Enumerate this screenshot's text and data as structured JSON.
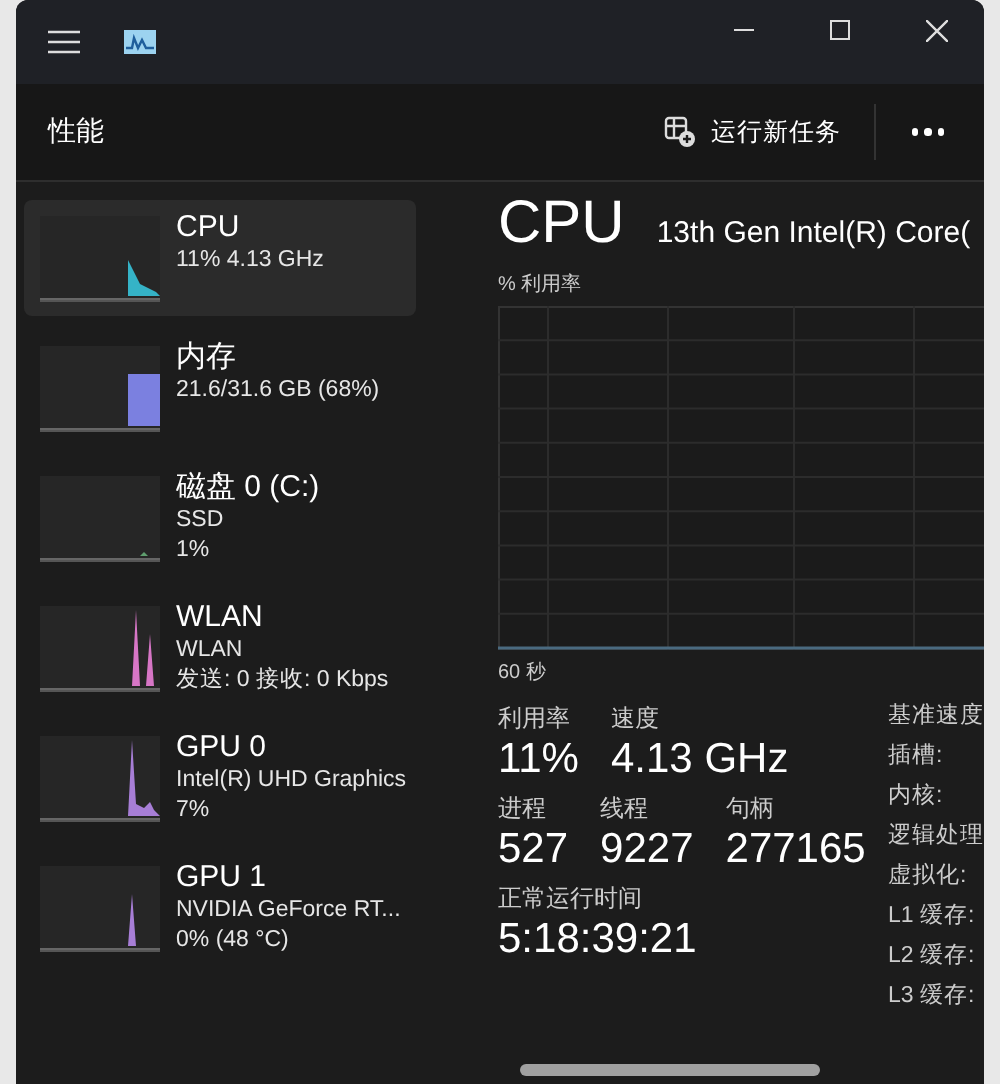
{
  "header": {
    "title": "性能",
    "run_task": "运行新任务"
  },
  "sidebar": {
    "items": [
      {
        "name": "CPU",
        "lines": [
          "11% 4.13 GHz"
        ],
        "color": "#35b3c7",
        "selected": true
      },
      {
        "name": "内存",
        "lines": [
          "21.6/31.6 GB (68%)"
        ],
        "color": "#7b80e0",
        "selected": false
      },
      {
        "name": "磁盘 0 (C:)",
        "lines": [
          "SSD",
          "1%"
        ],
        "color": "#5f9e6e",
        "selected": false
      },
      {
        "name": "WLAN",
        "lines": [
          "WLAN",
          "发送: 0 接收: 0 Kbps"
        ],
        "color": "#d776c6",
        "selected": false
      },
      {
        "name": "GPU 0",
        "lines": [
          "Intel(R) UHD Graphics",
          "7%"
        ],
        "color": "#a77ed6",
        "selected": false
      },
      {
        "name": "GPU 1",
        "lines": [
          "NVIDIA GeForce RT...",
          "0% (48 °C)"
        ],
        "color": "#a77ed6",
        "selected": false
      }
    ]
  },
  "detail": {
    "title": "CPU",
    "subtitle": "13th Gen Intel(R) Core(",
    "graph_label": "% 利用率",
    "graph_time": "60 秒",
    "stat_rows": [
      [
        {
          "label": "利用率",
          "value": "11%"
        },
        {
          "label": "速度",
          "value": "4.13 GHz"
        }
      ],
      [
        {
          "label": "进程",
          "value": "527"
        },
        {
          "label": "线程",
          "value": "9227"
        },
        {
          "label": "句柄",
          "value": "277165"
        }
      ],
      [
        {
          "label": "正常运行时间",
          "value": "5:18:39:21"
        }
      ]
    ],
    "specs": [
      "基准速度",
      "插槽:",
      "内核:",
      "逻辑处理",
      "虚拟化:",
      "L1 缓存:",
      "L2 缓存:",
      "L3 缓存:"
    ]
  }
}
